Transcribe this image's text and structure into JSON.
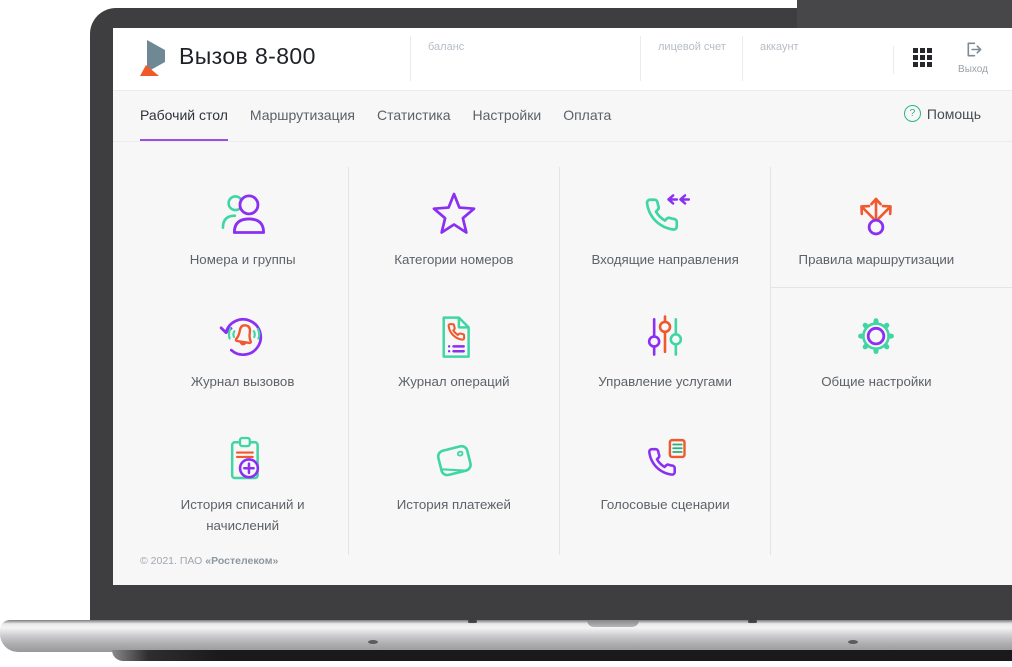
{
  "window": {
    "brand_title": "Вызов 8-800"
  },
  "topbar": {
    "fields": [
      {
        "label": "баланс"
      },
      {
        "label": "лицевой счет"
      },
      {
        "label": "аккаунт"
      }
    ],
    "logout_label": "Выход"
  },
  "nav": {
    "tabs": [
      {
        "label": "Рабочий стол",
        "active": true
      },
      {
        "label": "Маршрутизация",
        "active": false
      },
      {
        "label": "Статистика",
        "active": false
      },
      {
        "label": "Настройки",
        "active": false
      },
      {
        "label": "Оплата",
        "active": false
      }
    ],
    "help_label": "Помощь"
  },
  "tiles": [
    {
      "label": "Номера и группы",
      "icon": "users-icon"
    },
    {
      "label": "Категории номеров",
      "icon": "star-icon"
    },
    {
      "label": "Входящие направления",
      "icon": "incoming-call-icon"
    },
    {
      "label": "Правила маршрутизации",
      "icon": "routing-icon"
    },
    {
      "label": "Журнал вызовов",
      "icon": "call-log-icon"
    },
    {
      "label": "Журнал операций",
      "icon": "operations-log-icon"
    },
    {
      "label": "Управление услугами",
      "icon": "sliders-icon"
    },
    {
      "label": "Общие настройки",
      "icon": "gear-icon"
    },
    {
      "label": "История списаний и начислений",
      "icon": "charges-history-icon"
    },
    {
      "label": "История платежей",
      "icon": "wallet-icon"
    },
    {
      "label": "Голосовые сценарии",
      "icon": "voice-scenario-icon"
    }
  ],
  "footer": {
    "copyright_prefix": "© 2021. ПАО ",
    "copyright_brand": "«Ростелеком»"
  },
  "help_glyph": "?",
  "colors": {
    "purple": "#8b2ff2",
    "teal": "#3fd6a4",
    "orange": "#f0582d",
    "green": "#27b077",
    "tab_accent": "#9b51e0",
    "help_green": "#2cb784",
    "logo_slate": "#6e8894",
    "logo_orange": "#f05a28"
  }
}
